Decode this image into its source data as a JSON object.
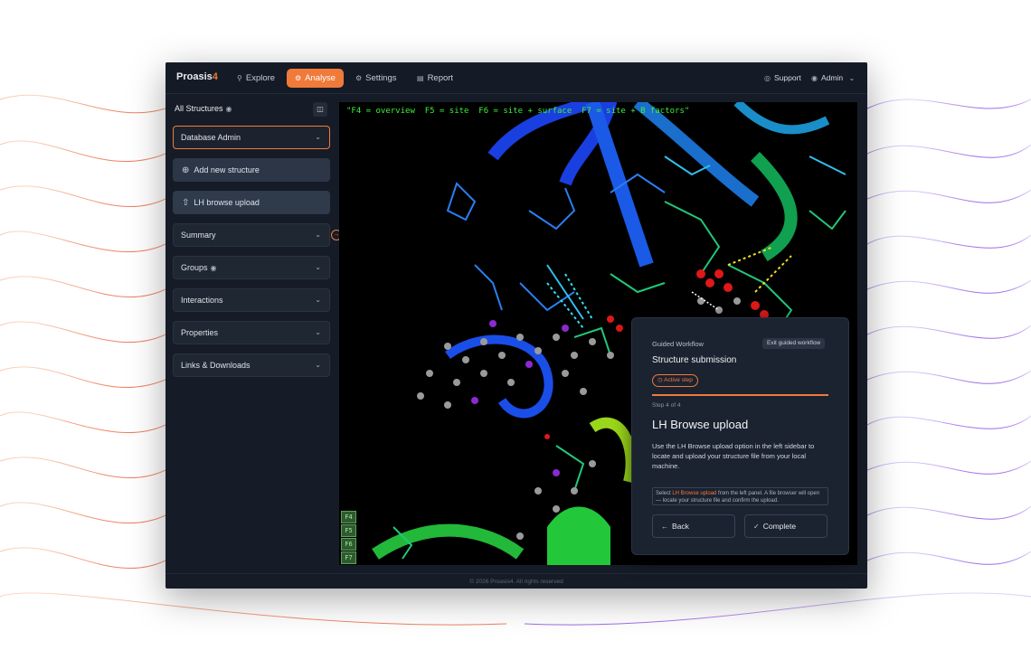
{
  "app": {
    "logo_text": "Proasis",
    "logo_accent": "4",
    "nav": [
      {
        "label": "Explore",
        "icon": "search-icon"
      },
      {
        "label": "Analyse",
        "icon": "analyse-icon",
        "active": true
      },
      {
        "label": "Settings",
        "icon": "gear-icon"
      },
      {
        "label": "Report",
        "icon": "document-icon"
      }
    ],
    "support_label": "Support",
    "user_label": "Admin"
  },
  "sidebar": {
    "header": "All Structures",
    "items": [
      {
        "label": "Database Admin"
      },
      {
        "label": "Add new structure"
      },
      {
        "label": "LH browse upload"
      },
      {
        "label": "Summary"
      },
      {
        "label": "Groups"
      },
      {
        "label": "Interactions"
      },
      {
        "label": "Properties"
      },
      {
        "label": "Links & Downloads"
      }
    ]
  },
  "viewer": {
    "hint": "\"F4 = overview  F5 = site  F6 = site + surface  F7 = site + B factors\"",
    "fkeys": [
      "F4",
      "F5",
      "F6",
      "F7"
    ]
  },
  "workflow": {
    "label": "Guided Workflow",
    "exit_label": "Exit guided workflow",
    "title": "Structure submission",
    "badge": "Active step",
    "progress": 1.0,
    "step": "Step 4 of 4",
    "heading": "LH Browse upload",
    "description": "Use the LH Browse upload option in the left sidebar to locate and upload your structure file from your local machine.",
    "tip_prefix": "Select ",
    "tip_highlight": "LH Browse upload",
    "tip_suffix": " from the left panel. A file browser will open — locate your structure file and confirm the upload.",
    "back_label": "Back",
    "complete_label": "Complete"
  },
  "footer": "© 2026 Proasis4. All rights reserved",
  "colors": {
    "accent": "#f07a3a",
    "background": "#161c27",
    "viewer": "#000000"
  }
}
